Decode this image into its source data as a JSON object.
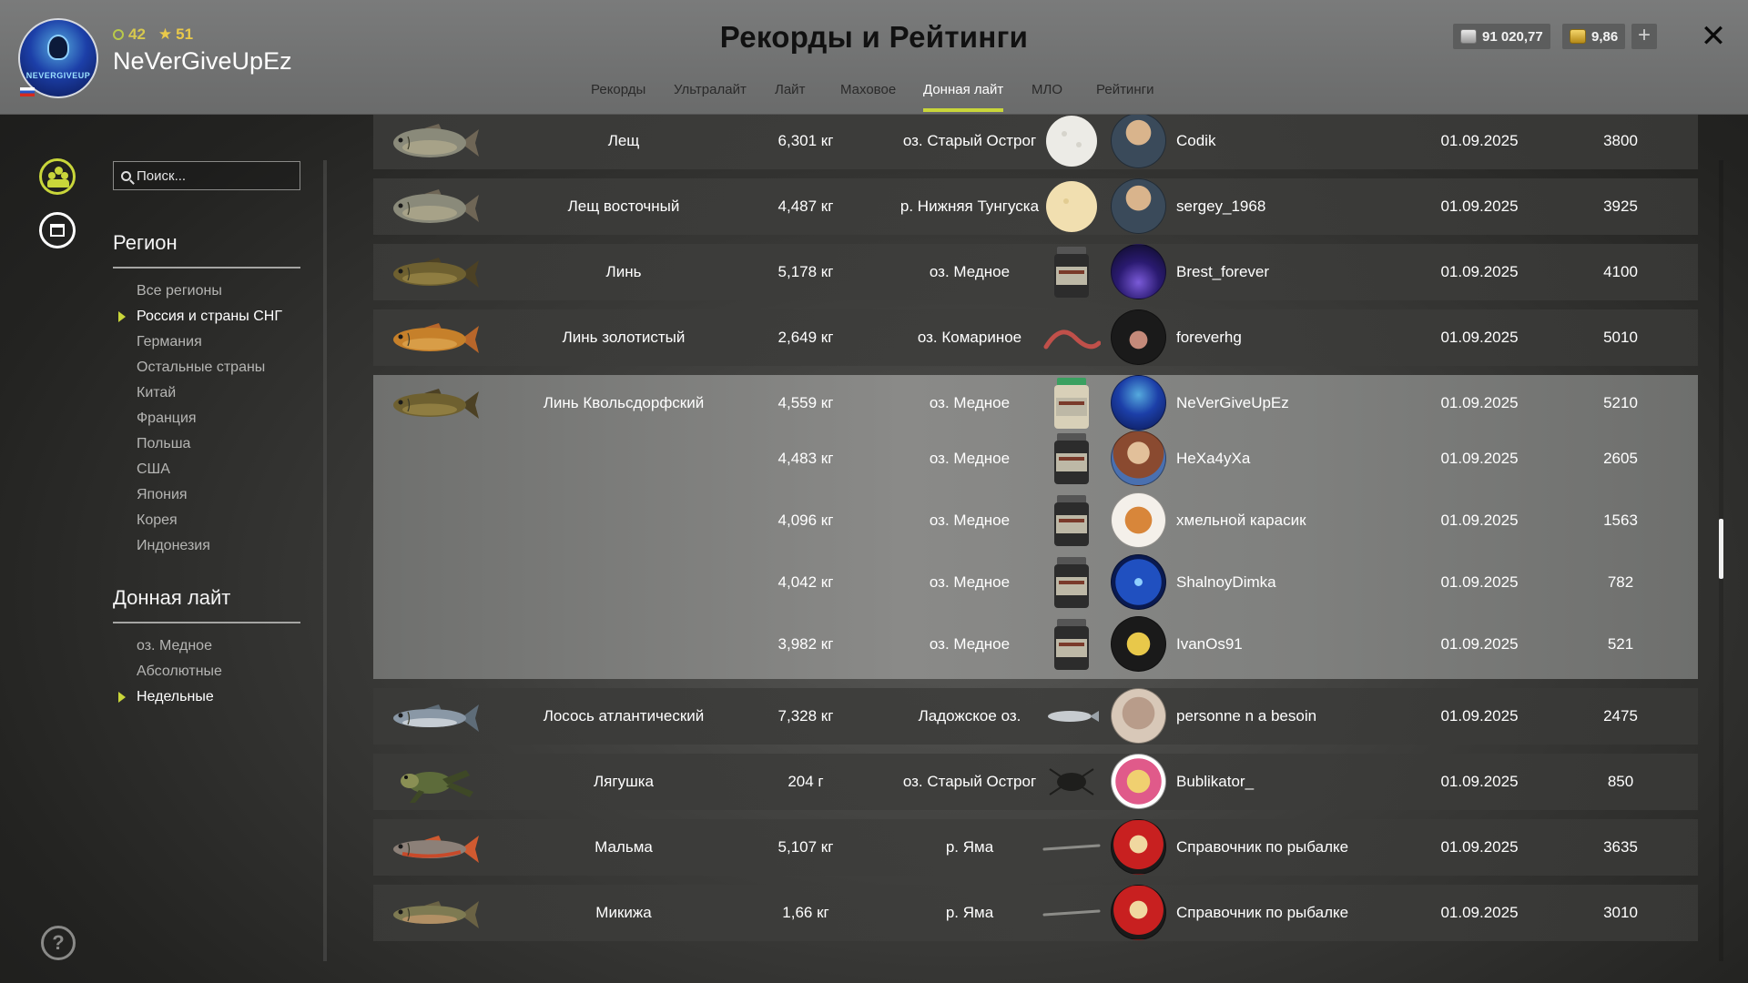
{
  "header": {
    "title": "Рекорды и Рейтинги",
    "player_name": "NeVerGiveUpEz",
    "avatar_text": "NEVERGIVEUP",
    "level": "42",
    "rank": "51",
    "silver": "91 020,77",
    "gold": "9,86",
    "plus_label": "+",
    "close_label": "✕"
  },
  "tabs": [
    {
      "label": "Рекорды",
      "active": false
    },
    {
      "label": "Ультралайт",
      "active": false
    },
    {
      "label": "Лайт",
      "active": false
    },
    {
      "label": "Маховое",
      "active": false
    },
    {
      "label": "Донная лайт",
      "active": true
    },
    {
      "label": "МЛО",
      "active": false
    },
    {
      "label": "Рейтинги",
      "active": false
    }
  ],
  "sidebar": {
    "search_placeholder": "Поиск...",
    "region_heading": "Регион",
    "regions": [
      {
        "label": "Все регионы",
        "active": false
      },
      {
        "label": "Россия и страны СНГ",
        "active": true
      },
      {
        "label": "Германия",
        "active": false
      },
      {
        "label": "Остальные страны",
        "active": false
      },
      {
        "label": "Китай",
        "active": false
      },
      {
        "label": "Франция",
        "active": false
      },
      {
        "label": "Польша",
        "active": false
      },
      {
        "label": "США",
        "active": false
      },
      {
        "label": "Япония",
        "active": false
      },
      {
        "label": "Корея",
        "active": false
      },
      {
        "label": "Индонезия",
        "active": false
      }
    ],
    "category_heading": "Донная лайт",
    "categories": [
      {
        "label": "оз. Медное",
        "active": false
      },
      {
        "label": "Абсолютные",
        "active": false
      },
      {
        "label": "Недельные",
        "active": true
      }
    ],
    "help_label": "?"
  },
  "records": [
    {
      "fish": "Лещ",
      "fish_icon": "bream",
      "highlight": false,
      "entries": [
        {
          "weight": "6,301 кг",
          "location": "оз. Старый Острог",
          "bait": "dough-bait",
          "player": "Codik",
          "avatar": "bearded-man",
          "date": "01.09.2025",
          "score": "3800"
        }
      ]
    },
    {
      "fish": "Лещ восточный",
      "fish_icon": "bream",
      "highlight": false,
      "entries": [
        {
          "weight": "4,487 кг",
          "location": "р. Нижняя Тунгуска",
          "bait": "dough-bait-yellow",
          "player": "sergey_1968",
          "avatar": "bearded-man",
          "date": "01.09.2025",
          "score": "3925"
        }
      ]
    },
    {
      "fish": "Линь",
      "fish_icon": "tench",
      "highlight": false,
      "entries": [
        {
          "weight": "5,178 кг",
          "location": "оз. Медное",
          "bait": "groundbait-jar",
          "player": "Brest_forever",
          "avatar": "night-scene",
          "date": "01.09.2025",
          "score": "4100"
        }
      ]
    },
    {
      "fish": "Линь золотистый",
      "fish_icon": "golden-tench",
      "highlight": false,
      "entries": [
        {
          "weight": "2,649 кг",
          "location": "оз. Комариное",
          "bait": "worm",
          "player": "foreverhg",
          "avatar": "helmet-person",
          "date": "01.09.2025",
          "score": "5010"
        }
      ]
    },
    {
      "fish": "Линь Квольсдорфский",
      "fish_icon": "tench",
      "highlight": true,
      "entries": [
        {
          "weight": "4,559 кг",
          "location": "оз. Медное",
          "bait": "groundbait-jar-green",
          "player": "NeVerGiveUpEz",
          "avatar": "blue-mask",
          "date": "01.09.2025",
          "score": "5210"
        },
        {
          "weight": "4,483 кг",
          "location": "оз. Медное",
          "bait": "groundbait-jar",
          "player": "HeXa4yXa",
          "avatar": "anime-girl",
          "date": "01.09.2025",
          "score": "2605"
        },
        {
          "weight": "4,096 кг",
          "location": "оз. Медное",
          "bait": "groundbait-jar",
          "player": "хмельной карасик",
          "avatar": "hamster",
          "date": "01.09.2025",
          "score": "1563"
        },
        {
          "weight": "4,042 кг",
          "location": "оз. Медное",
          "bait": "groundbait-jar",
          "player": "ShalnoyDimka",
          "avatar": "fireworks",
          "date": "01.09.2025",
          "score": "782"
        },
        {
          "weight": "3,982 кг",
          "location": "оз. Медное",
          "bait": "groundbait-jar",
          "player": "IvanOs91",
          "avatar": "letter-a",
          "date": "01.09.2025",
          "score": "521"
        }
      ]
    },
    {
      "fish": "Лосось атлантический",
      "fish_icon": "salmon",
      "highlight": false,
      "entries": [
        {
          "weight": "7,328 кг",
          "location": "Ладожское оз.",
          "bait": "small-fish",
          "player": "personne n a besoin",
          "avatar": "cat-glasses",
          "date": "01.09.2025",
          "score": "2475"
        }
      ]
    },
    {
      "fish": "Лягушка",
      "fish_icon": "frog",
      "highlight": false,
      "entries": [
        {
          "weight": "204 г",
          "location": "оз. Старый Острог",
          "bait": "beetle",
          "player": "Bublikator_",
          "avatar": "anime-hero",
          "date": "01.09.2025",
          "score": "850"
        }
      ]
    },
    {
      "fish": "Мальма",
      "fish_icon": "char",
      "highlight": false,
      "entries": [
        {
          "weight": "5,107 кг",
          "location": "р. Яма",
          "bait": "thin-lure",
          "player": "Справочник по рыбалке",
          "avatar": "team-logo",
          "date": "01.09.2025",
          "score": "3635"
        }
      ]
    },
    {
      "fish": "Микижа",
      "fish_icon": "trout",
      "highlight": false,
      "entries": [
        {
          "weight": "1,66 кг",
          "location": "р. Яма",
          "bait": "thin-lure",
          "player": "Справочник по рыбалке",
          "avatar": "team-logo",
          "date": "01.09.2025",
          "score": "3010"
        }
      ]
    }
  ],
  "colors": {
    "accent": "#c9d63a",
    "header_bg": "#707171",
    "title": "#111111"
  }
}
